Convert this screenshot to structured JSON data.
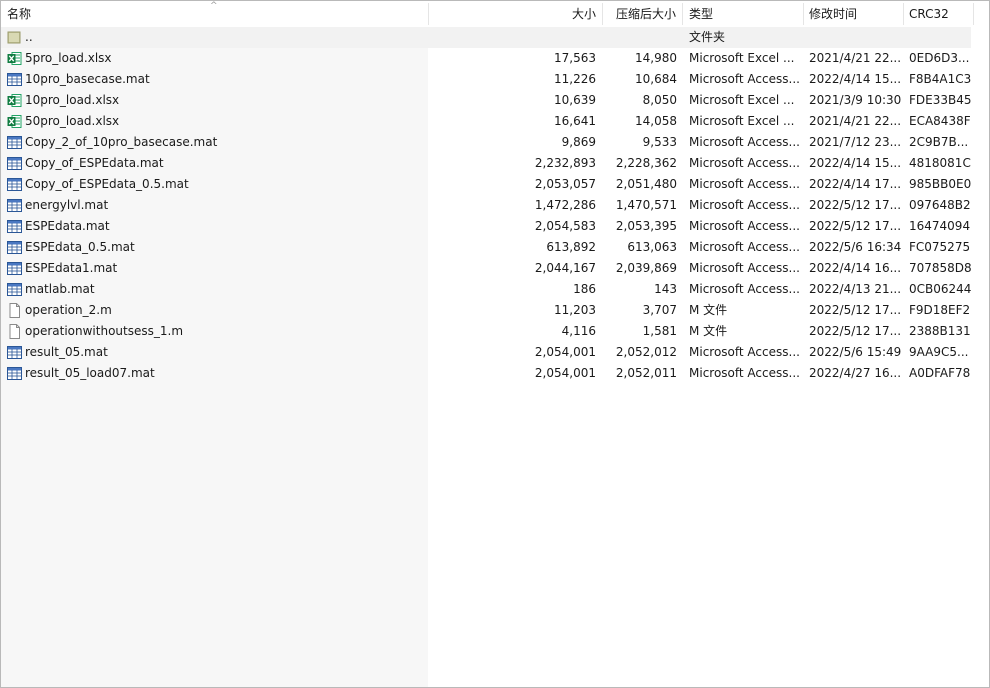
{
  "columns": {
    "name": "名称",
    "size": "大小",
    "packed": "压缩后大小",
    "type": "类型",
    "modified": "修改时间",
    "crc": "CRC32"
  },
  "sort_indicator": "^",
  "parent_row": {
    "name": "..",
    "type": "文件夹",
    "icon": "folder-icon"
  },
  "files": [
    {
      "name": "5pro_load.xlsx",
      "size": "17,563",
      "packed": "14,980",
      "type": "Microsoft Excel ...",
      "modified": "2021/4/21 22...",
      "crc": "0ED6D3...",
      "icon": "excel-icon"
    },
    {
      "name": "10pro_basecase.mat",
      "size": "11,226",
      "packed": "10,684",
      "type": "Microsoft Access...",
      "modified": "2022/4/14 15...",
      "crc": "F8B4A1C3",
      "icon": "access-table-icon"
    },
    {
      "name": "10pro_load.xlsx",
      "size": "10,639",
      "packed": "8,050",
      "type": "Microsoft Excel ...",
      "modified": "2021/3/9 10:30",
      "crc": "FDE33B45",
      "icon": "excel-icon"
    },
    {
      "name": "50pro_load.xlsx",
      "size": "16,641",
      "packed": "14,058",
      "type": "Microsoft Excel ...",
      "modified": "2021/4/21 22...",
      "crc": "ECA8438F",
      "icon": "excel-icon"
    },
    {
      "name": "Copy_2_of_10pro_basecase.mat",
      "size": "9,869",
      "packed": "9,533",
      "type": "Microsoft Access...",
      "modified": "2021/7/12 23...",
      "crc": "2C9B7B...",
      "icon": "access-table-icon"
    },
    {
      "name": "Copy_of_ESPEdata.mat",
      "size": "2,232,893",
      "packed": "2,228,362",
      "type": "Microsoft Access...",
      "modified": "2022/4/14 15...",
      "crc": "4818081C",
      "icon": "access-table-icon"
    },
    {
      "name": "Copy_of_ESPEdata_0.5.mat",
      "size": "2,053,057",
      "packed": "2,051,480",
      "type": "Microsoft Access...",
      "modified": "2022/4/14 17...",
      "crc": "985BB0E0",
      "icon": "access-table-icon"
    },
    {
      "name": "energylvl.mat",
      "size": "1,472,286",
      "packed": "1,470,571",
      "type": "Microsoft Access...",
      "modified": "2022/5/12 17...",
      "crc": "097648B2",
      "icon": "access-table-icon"
    },
    {
      "name": "ESPEdata.mat",
      "size": "2,054,583",
      "packed": "2,053,395",
      "type": "Microsoft Access...",
      "modified": "2022/5/12 17...",
      "crc": "16474094",
      "icon": "access-table-icon"
    },
    {
      "name": "ESPEdata_0.5.mat",
      "size": "613,892",
      "packed": "613,063",
      "type": "Microsoft Access...",
      "modified": "2022/5/6 16:34",
      "crc": "FC075275",
      "icon": "access-table-icon"
    },
    {
      "name": "ESPEdata1.mat",
      "size": "2,044,167",
      "packed": "2,039,869",
      "type": "Microsoft Access...",
      "modified": "2022/4/14 16...",
      "crc": "707858D8",
      "icon": "access-table-icon"
    },
    {
      "name": "matlab.mat",
      "size": "186",
      "packed": "143",
      "type": "Microsoft Access...",
      "modified": "2022/4/13 21...",
      "crc": "0CB06244",
      "icon": "access-table-icon"
    },
    {
      "name": "operation_2.m",
      "size": "11,203",
      "packed": "3,707",
      "type": "M 文件",
      "modified": "2022/5/12 17...",
      "crc": "F9D18EF2",
      "icon": "blank-file-icon"
    },
    {
      "name": "operationwithoutsess_1.m",
      "size": "4,116",
      "packed": "1,581",
      "type": "M 文件",
      "modified": "2022/5/12 17...",
      "crc": "2388B131",
      "icon": "blank-file-icon"
    },
    {
      "name": "result_05.mat",
      "size": "2,054,001",
      "packed": "2,052,012",
      "type": "Microsoft Access...",
      "modified": "2022/5/6 15:49",
      "crc": "9AA9C5...",
      "icon": "access-table-icon"
    },
    {
      "name": "result_05_load07.mat",
      "size": "2,054,001",
      "packed": "2,052,011",
      "type": "Microsoft Access...",
      "modified": "2022/4/27 16...",
      "crc": "A0DFAF78",
      "icon": "access-table-icon"
    }
  ]
}
